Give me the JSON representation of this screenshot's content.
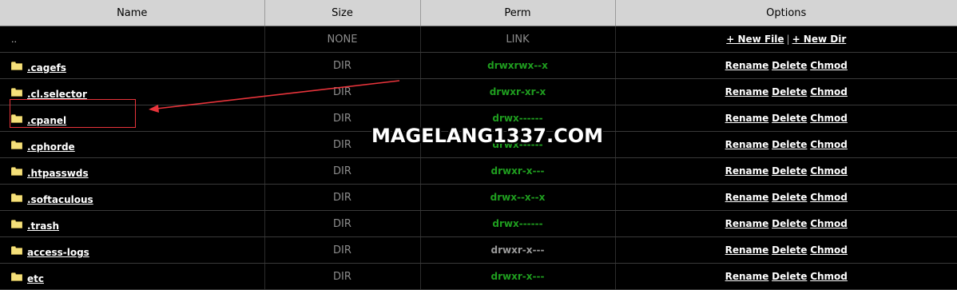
{
  "headers": {
    "name": "Name",
    "size": "Size",
    "perm": "Perm",
    "options": "Options"
  },
  "parent_row": {
    "name": "..",
    "size": "NONE",
    "perm": "LINK",
    "new_file": "+ New File",
    "separator": "|",
    "new_dir": "+ New Dir"
  },
  "rows": [
    {
      "name": ".cagefs",
      "size": "DIR",
      "perm": "drwxrwx--x",
      "perm_color": "#1f9e1f"
    },
    {
      "name": ".cl.selector",
      "size": "DIR",
      "perm": "drwxr-xr-x",
      "perm_color": "#1f9e1f"
    },
    {
      "name": ".cpanel",
      "size": "DIR",
      "perm": "drwx------",
      "perm_color": "#1f9e1f"
    },
    {
      "name": ".cphorde",
      "size": "DIR",
      "perm": "drwx------",
      "perm_color": "#1f9e1f"
    },
    {
      "name": ".htpasswds",
      "size": "DIR",
      "perm": "drwxr-x---",
      "perm_color": "#1f9e1f"
    },
    {
      "name": ".softaculous",
      "size": "DIR",
      "perm": "drwx--x--x",
      "perm_color": "#1f9e1f"
    },
    {
      "name": ".trash",
      "size": "DIR",
      "perm": "drwx------",
      "perm_color": "#1f9e1f"
    },
    {
      "name": "access-logs",
      "size": "DIR",
      "perm": "drwxr-x---",
      "perm_color": "#9a9a9a"
    },
    {
      "name": "etc",
      "size": "DIR",
      "perm": "drwxr-x---",
      "perm_color": "#1f9e1f"
    }
  ],
  "row_actions": {
    "rename": "Rename",
    "delete": "Delete",
    "chmod": "Chmod"
  },
  "watermark": "MAGELANG1337.COM",
  "colors": {
    "header_bg": "#d4d4d4",
    "bg": "#000000",
    "perm_green": "#1f9e1f",
    "annotation_red": "#e8343b",
    "folder_yellow": "#f5e07a"
  },
  "icons": {
    "folder": "folder-icon"
  }
}
